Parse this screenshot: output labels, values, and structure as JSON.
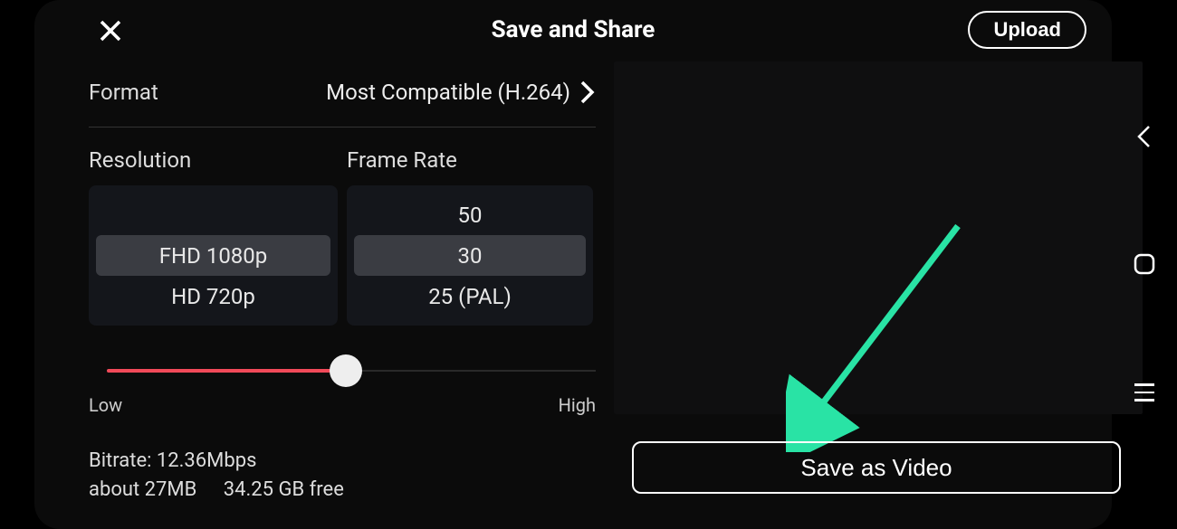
{
  "header": {
    "title": "Save and Share",
    "upload_label": "Upload"
  },
  "format": {
    "label": "Format",
    "value": "Most Compatible (H.264)"
  },
  "resolution": {
    "label": "Resolution",
    "options": [
      "",
      "FHD 1080p",
      "HD 720p"
    ],
    "selected": "FHD 1080p"
  },
  "frame_rate": {
    "label": "Frame Rate",
    "options": [
      "50",
      "30",
      "25 (PAL)"
    ],
    "selected": "30"
  },
  "quality_slider": {
    "low_label": "Low",
    "high_label": "High"
  },
  "bitrate": {
    "line1": "Bitrate: 12.36Mbps",
    "size": "about 27MB",
    "free": "34.25 GB free"
  },
  "save_button_label": "Save as Video",
  "annotation": {
    "arrow_color": "#29e3a5"
  }
}
